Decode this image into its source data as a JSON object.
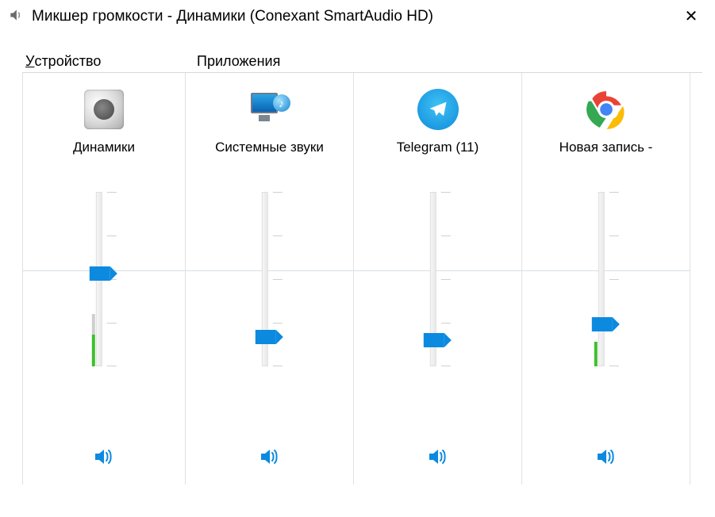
{
  "window": {
    "title": "Микшер громкости - Динамики (Conexant SmartAudio HD)"
  },
  "sections": {
    "device_label": "Устройство",
    "apps_label": "Приложения"
  },
  "device": {
    "name": "Динамики",
    "slider_percent": 53,
    "meter_percent": 18,
    "grey_percent": 12,
    "muted": false
  },
  "apps": [
    {
      "name": "Системные звуки",
      "icon": "system-sounds-icon",
      "slider_percent": 17,
      "meter_percent": 0,
      "muted": false
    },
    {
      "name": "Telegram (11)",
      "icon": "telegram-icon",
      "slider_percent": 15,
      "meter_percent": 0,
      "muted": false
    },
    {
      "name": "Новая запись -",
      "icon": "chrome-icon",
      "slider_percent": 24,
      "meter_percent": 14,
      "muted": false
    }
  ],
  "colors": {
    "accent": "#0b8ae0",
    "meter_green": "#3fbf2e"
  }
}
